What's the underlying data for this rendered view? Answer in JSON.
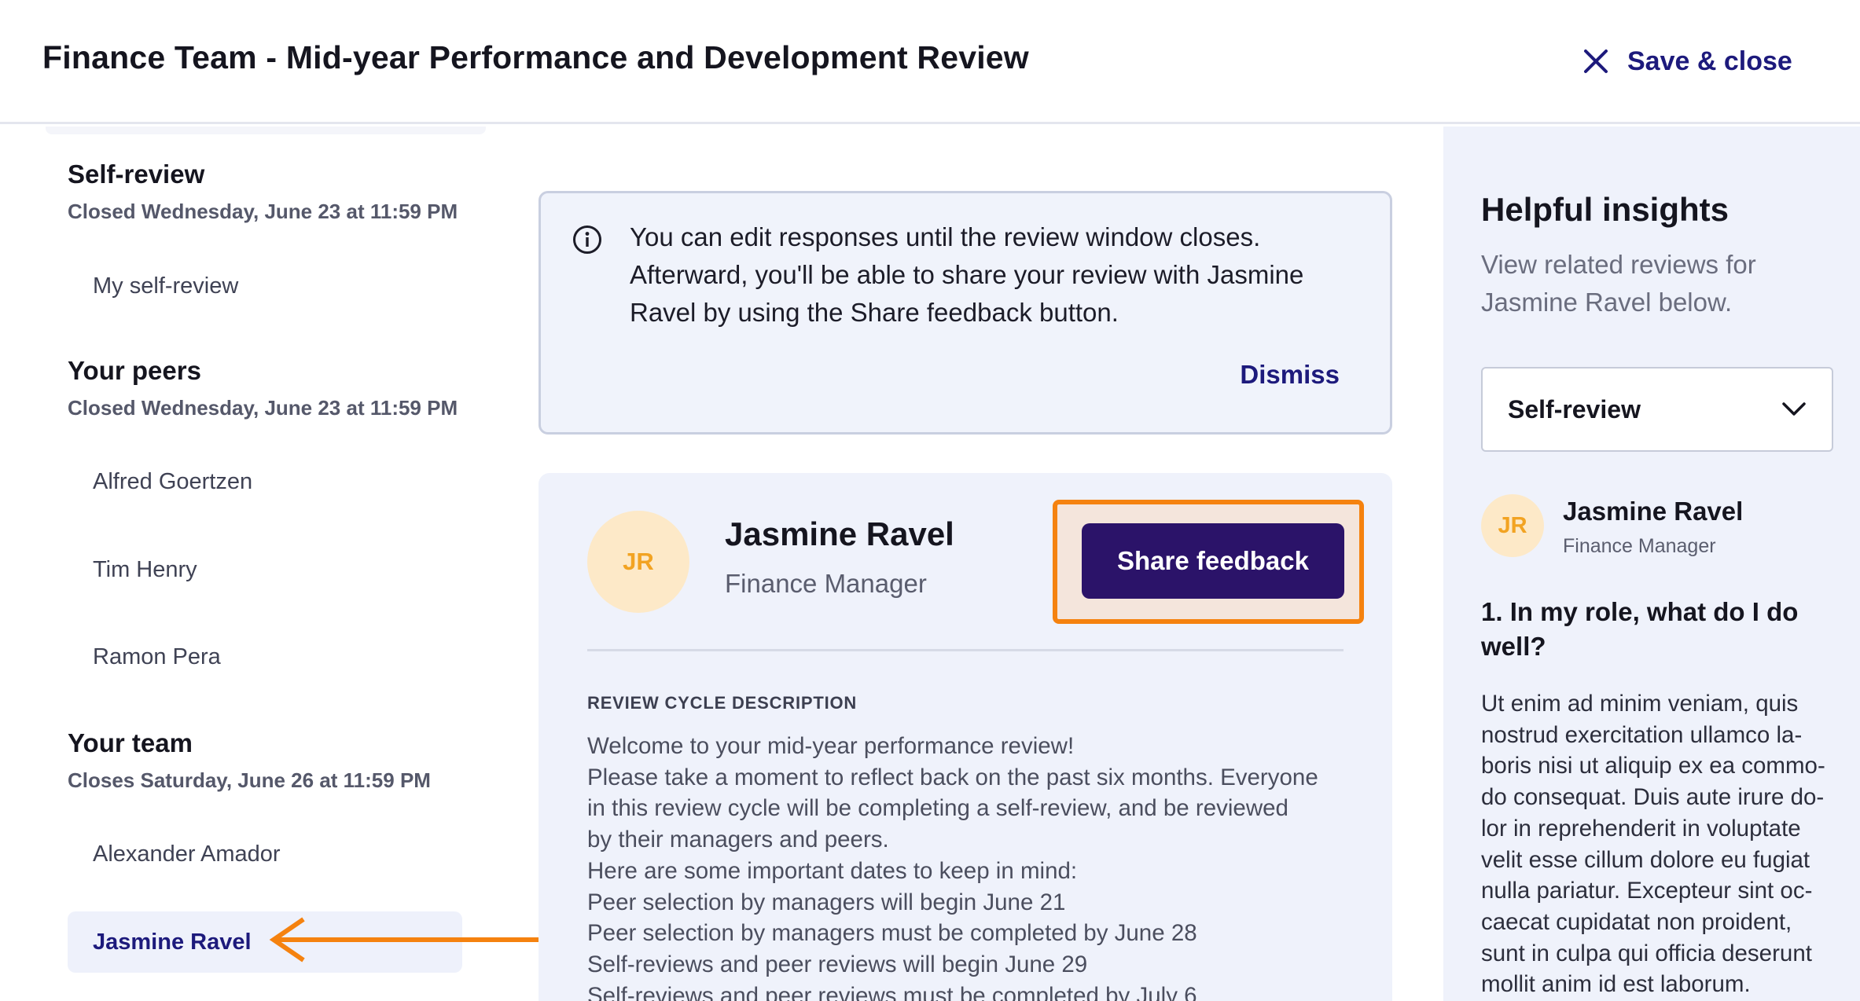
{
  "header": {
    "title": "Finance Team - Mid-year Performance and Development Review",
    "save_close_label": "Save & close",
    "close_icon": "close-icon"
  },
  "sidebar": {
    "sections": [
      {
        "title": "Self-review",
        "subtitle": "Closed Wednesday, June 23 at 11:59 PM",
        "items": [
          "My self-review"
        ]
      },
      {
        "title": "Your peers",
        "subtitle": "Closed Wednesday, June 23 at 11:59 PM",
        "items": [
          "Alfred Goertzen",
          "Tim Henry",
          "Ramon Pera"
        ]
      },
      {
        "title": "Your team",
        "subtitle": "Closes Saturday, June 26 at 11:59 PM",
        "items": [
          "Alexander Amador",
          "Jasmine Ravel"
        ]
      }
    ],
    "active_item": "Jasmine Ravel"
  },
  "info_banner": {
    "icon": "info-icon",
    "text": "You can edit responses until the review window closes. Afterward, you'll be able to share your review with Jasmine Ravel by using the Share feedback button.",
    "dismiss_label": "Dismiss"
  },
  "profile": {
    "initials": "JR",
    "name": "Jasmine Ravel",
    "role": "Finance Manager",
    "share_button_label": "Share feedback"
  },
  "review_cycle": {
    "heading": "REVIEW CYCLE DESCRIPTION",
    "lines": [
      "Welcome to your mid-year performance review!",
      "Please take a moment to reflect back on the past six months. Everyone",
      "in this review cycle will be completing a self-review, and be reviewed",
      "by their managers and peers.",
      "Here are some important dates to keep in mind:",
      "Peer selection by managers will begin June 21",
      "Peer selection by managers must be completed by June 28",
      "Self-reviews and peer reviews will begin June 29",
      "Self-reviews and peer reviews must be completed by July 6"
    ]
  },
  "insights": {
    "title": "Helpful insights",
    "subtitle": "View related reviews for Jasmine Ravel below.",
    "select_value": "Self-review",
    "select_icon": "chevron-down-icon",
    "reviewer": {
      "initials": "JR",
      "name": "Jasmine Ravel",
      "role": "Finance Manager"
    },
    "question": "1. In my role, what do I do well?",
    "answer_lines": [
      "Ut enim ad minim veniam, quis",
      "nostrud exercitation ullamco la-",
      "boris nisi ut aliquip ex ea commo-",
      "do consequat. Duis aute irure do-",
      "lor in reprehenderit in voluptate",
      "velit esse cillum dolore eu fugiat",
      "nulla pariatur. Excepteur sint oc-",
      "caecat cupidatat non proident,",
      "sunt in culpa qui officia deserunt",
      "mollit anim id est laborum."
    ]
  },
  "colors": {
    "accent": "#1d1a7c",
    "button": "#2b1369",
    "highlight": "#f5820f",
    "avatar_bg": "#fde9c8",
    "avatar_text": "#f2a322"
  }
}
